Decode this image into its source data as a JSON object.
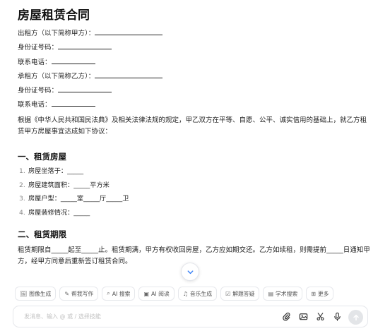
{
  "document": {
    "title": "房屋租赁合同",
    "fields": [
      {
        "label": "出租方（以下简称甲方）："
      },
      {
        "label": "身份证号码："
      },
      {
        "label": "联系电话："
      },
      {
        "label": "承租方（以下简称乙方）："
      },
      {
        "label": "身份证号码："
      },
      {
        "label": "联系电话："
      }
    ],
    "intro": "根据《中华人民共和国民法典》及相关法律法规的规定，甲乙双方在平等、自愿、公平、诚实信用的基础上，就乙方租赁甲方房屋事宜达成如下协议：",
    "section1": {
      "title": "一、租赁房屋",
      "items": [
        {
          "num": "1.",
          "text": "房屋坐落于：_____"
        },
        {
          "num": "2.",
          "text": "房屋建筑面积：_____平方米"
        },
        {
          "num": "3.",
          "text": "房屋户型：_____室_____厅_____卫"
        },
        {
          "num": "4.",
          "text": "房屋装修情况：_____"
        }
      ]
    },
    "section2": {
      "title": "二、租赁期限",
      "text": "租赁期限自_____起至_____止。租赁期满，甲方有权收回房屋，乙方应如期交还。乙方如续租，则需提前_____日通知甲方，经甲方同意后重新签订租赁合同。"
    }
  },
  "toolbar": {
    "chips": [
      {
        "icon": "🖼",
        "label": "图像生成"
      },
      {
        "icon": "✎",
        "label": "帮我写作"
      },
      {
        "icon": "⌕",
        "label": "AI 搜索"
      },
      {
        "icon": "▣",
        "label": "AI 阅读"
      },
      {
        "icon": "♫",
        "label": "音乐生成"
      },
      {
        "icon": "☑",
        "label": "解题答疑"
      },
      {
        "icon": "▤",
        "label": "学术搜索"
      },
      {
        "icon": "⊞",
        "label": "更多"
      }
    ]
  },
  "composer": {
    "placeholder": "发消息、输入 @ 或 / 选择技能"
  }
}
